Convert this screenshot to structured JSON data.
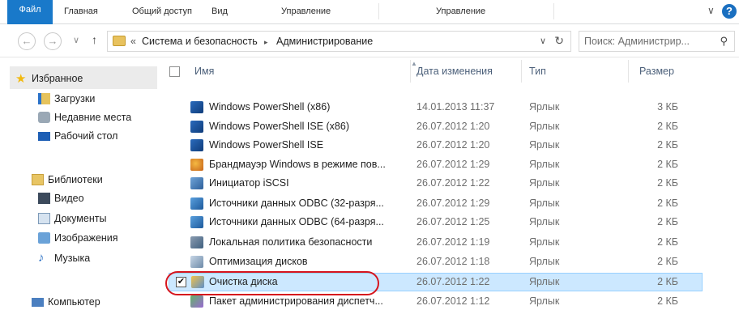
{
  "ribbon": {
    "tabs": [
      {
        "label": "Файл"
      },
      {
        "label": "Главная"
      },
      {
        "label": "Общий доступ"
      },
      {
        "label": "Вид"
      },
      {
        "label": "Управление"
      },
      {
        "label": "Управление"
      }
    ],
    "help_label": "?"
  },
  "address": {
    "prefix": "«",
    "crumbs": [
      "Система и безопасность",
      "Администрирование"
    ],
    "separator": "▸"
  },
  "search": {
    "placeholder": "Поиск: Администрир..."
  },
  "nav": {
    "favorites": "Избранное",
    "favorite_items": [
      "Загрузки",
      "Недавние места",
      "Рабочий стол"
    ],
    "libraries": "Библиотеки",
    "library_items": [
      "Видео",
      "Документы",
      "Изображения",
      "Музыка"
    ],
    "computer": "Компьютер"
  },
  "columns": {
    "name": "Имя",
    "date": "Дата изменения",
    "type": "Тип",
    "size": "Размер"
  },
  "files": [
    {
      "name": "Windows PowerShell (x86)",
      "date": "14.01.2013 11:37",
      "type": "Ярлык",
      "size": "3 КБ",
      "icon": "powershell-icon"
    },
    {
      "name": "Windows PowerShell ISE (x86)",
      "date": "26.07.2012 1:20",
      "type": "Ярлык",
      "size": "2 КБ",
      "icon": "powershell-icon"
    },
    {
      "name": "Windows PowerShell ISE",
      "date": "26.07.2012 1:20",
      "type": "Ярлык",
      "size": "2 КБ",
      "icon": "powershell-icon"
    },
    {
      "name": "Брандмауэр Windows в режиме пов...",
      "date": "26.07.2012 1:29",
      "type": "Ярлык",
      "size": "2 КБ",
      "icon": "firewall-icon"
    },
    {
      "name": "Инициатор iSCSI",
      "date": "26.07.2012 1:22",
      "type": "Ярлык",
      "size": "2 КБ",
      "icon": "iscsi-icon"
    },
    {
      "name": "Источники данных ODBC (32-разря...",
      "date": "26.07.2012 1:29",
      "type": "Ярлык",
      "size": "2 КБ",
      "icon": "odbc-icon"
    },
    {
      "name": "Источники данных ODBC (64-разря...",
      "date": "26.07.2012 1:25",
      "type": "Ярлык",
      "size": "2 КБ",
      "icon": "odbc-icon"
    },
    {
      "name": "Локальная политика безопасности",
      "date": "26.07.2012 1:19",
      "type": "Ярлык",
      "size": "2 КБ",
      "icon": "security-policy-icon"
    },
    {
      "name": "Оптимизация дисков",
      "date": "26.07.2012 1:18",
      "type": "Ярлык",
      "size": "2 КБ",
      "icon": "defrag-icon"
    },
    {
      "name": "Очистка диска",
      "date": "26.07.2012 1:22",
      "type": "Ярлык",
      "size": "2 КБ",
      "icon": "disk-cleanup-icon",
      "selected": true,
      "checked": "✔"
    },
    {
      "name": "Пакет администрирования диспетч...",
      "date": "26.07.2012 1:12",
      "type": "Ярлык",
      "size": "2 КБ",
      "icon": "admin-pack-icon"
    }
  ]
}
